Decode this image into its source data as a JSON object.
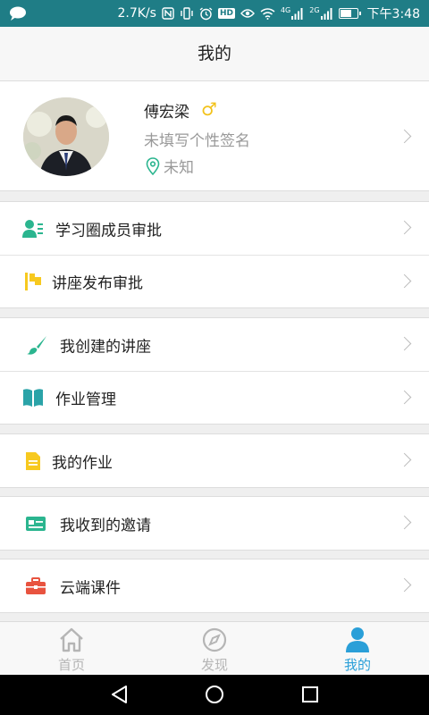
{
  "status_bar": {
    "speed": "2.7K/s",
    "time": "下午3:48",
    "net1": "4G",
    "net2": "2G",
    "hd_badge": "HD",
    "icons": [
      "chat-icon",
      "nfc-icon",
      "vibrate-icon",
      "alarm-icon",
      "hd-icon",
      "eye-icon",
      "wifi-icon",
      "signal-icon",
      "battery-icon"
    ]
  },
  "title": "我的",
  "profile": {
    "name": "傅宏梁",
    "gender_symbol": "♂",
    "signature": "未填写个性签名",
    "location": "未知"
  },
  "menu": {
    "group1": [
      {
        "label": "学习圈成员审批",
        "icon": "members-approve-icon"
      },
      {
        "label": "讲座发布审批",
        "icon": "flag-icon"
      }
    ],
    "group2": [
      {
        "label": "我创建的讲座",
        "icon": "brush-icon"
      },
      {
        "label": "作业管理",
        "icon": "book-icon"
      }
    ],
    "group3": [
      {
        "label": "我的作业",
        "icon": "document-icon"
      }
    ],
    "group4": [
      {
        "label": "我收到的邀请",
        "icon": "card-icon"
      }
    ],
    "group5": [
      {
        "label": "云端课件",
        "icon": "briefcase-icon"
      }
    ]
  },
  "tabs": [
    {
      "label": "首页",
      "icon": "home-icon",
      "active": false
    },
    {
      "label": "发现",
      "icon": "compass-icon",
      "active": false
    },
    {
      "label": "我的",
      "icon": "person-icon",
      "active": true
    }
  ],
  "colors": {
    "status_bar": "#1f7d86",
    "accent_blue": "#2a9fd8",
    "green": "#2bb58f",
    "yellow": "#f7c91f",
    "teal": "#2aa3a8",
    "red": "#e8533f"
  }
}
